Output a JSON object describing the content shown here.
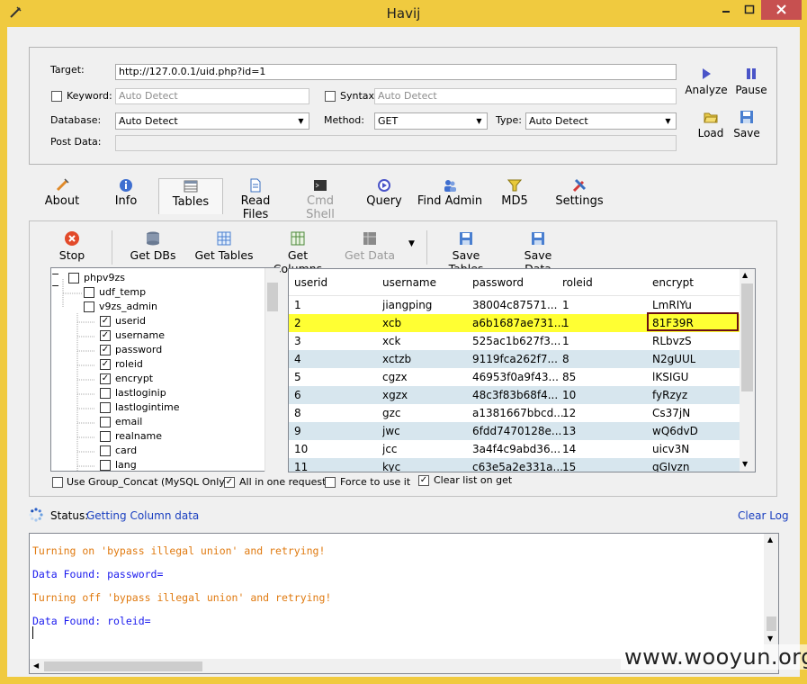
{
  "window": {
    "title": "Havij"
  },
  "target": {
    "target_label": "Target:",
    "target_value": "http://127.0.0.1/uid.php?id=1",
    "keyword_label": "Keyword:",
    "keyword_placeholder": "Auto Detect",
    "syntax_label": "Syntax:",
    "syntax_placeholder": "Auto Detect",
    "database_label": "Database:",
    "database_value": "Auto Detect",
    "method_label": "Method:",
    "method_value": "GET",
    "type_label": "Type:",
    "type_value": "Auto Detect",
    "postdata_label": "Post Data:"
  },
  "side_buttons": {
    "analyze": "Analyze",
    "pause": "Pause",
    "load": "Load",
    "save": "Save"
  },
  "tabs": [
    {
      "label": "About"
    },
    {
      "label": "Info"
    },
    {
      "label": "Tables"
    },
    {
      "label": "Read Files"
    },
    {
      "label": "Cmd Shell"
    },
    {
      "label": "Query"
    },
    {
      "label": "Find Admin"
    },
    {
      "label": "MD5"
    },
    {
      "label": "Settings"
    }
  ],
  "toolbar": {
    "stop": "Stop",
    "get_dbs": "Get DBs",
    "get_tables": "Get Tables",
    "get_columns": "Get Columns",
    "get_data": "Get Data",
    "save_tables": "Save Tables",
    "save_data": "Save Data"
  },
  "tree": {
    "db": "phpv9zs",
    "tables": [
      "udf_temp",
      "v9zs_admin"
    ],
    "columns": [
      {
        "name": "userid",
        "checked": true
      },
      {
        "name": "username",
        "checked": true
      },
      {
        "name": "password",
        "checked": true
      },
      {
        "name": "roleid",
        "checked": true
      },
      {
        "name": "encrypt",
        "checked": true
      },
      {
        "name": "lastloginip",
        "checked": false
      },
      {
        "name": "lastlogintime",
        "checked": false
      },
      {
        "name": "email",
        "checked": false
      },
      {
        "name": "realname",
        "checked": false
      },
      {
        "name": "card",
        "checked": false
      },
      {
        "name": "lang",
        "checked": false
      }
    ]
  },
  "grid": {
    "headers": [
      "userid",
      "username",
      "password",
      "roleid",
      "encrypt"
    ],
    "rows": [
      [
        "1",
        "jiangping",
        "38004c87571...",
        "1",
        "LmRIYu"
      ],
      [
        "2",
        "xcb",
        "a6b1687ae731...",
        "1",
        "81F39R"
      ],
      [
        "3",
        "xck",
        "525ac1b627f3...",
        "1",
        "RLbvzS"
      ],
      [
        "4",
        "xctzb",
        "9119fca262f7...",
        "8",
        "N2gUUL"
      ],
      [
        "5",
        "cgzx",
        "46953f0a9f43...",
        "85",
        "lKSIGU"
      ],
      [
        "6",
        "xgzx",
        "48c3f83b68f4...",
        "10",
        "fyRzyz"
      ],
      [
        "8",
        "gzc",
        "a1381667bbcd...",
        "12",
        "Cs37jN"
      ],
      [
        "9",
        "jwc",
        "6fdd7470128e...",
        "13",
        "wQ6dvD"
      ],
      [
        "10",
        "jcc",
        "3a4f4c9abd36...",
        "14",
        "uicv3N"
      ],
      [
        "11",
        "kyc",
        "c63e5a2e331a...",
        "15",
        "qGIvzn"
      ]
    ]
  },
  "options": {
    "group_concat": "Use Group_Concat (MySQL Only)",
    "all_in_one": "All in one request.",
    "force": "Force to use it",
    "clear_list": "Clear list on get"
  },
  "status": {
    "label": "Status:",
    "value": "Getting Column data",
    "clear_log": "Clear Log"
  },
  "log": [
    {
      "text": "Turning on 'bypass illegal union' and retrying!",
      "color": "orange"
    },
    {
      "text": "Data Found: password=",
      "color": "blue"
    },
    {
      "text": "Turning off 'bypass illegal union' and retrying!",
      "color": "orange"
    },
    {
      "text": "Data Found: roleid=",
      "color": "blue"
    }
  ],
  "watermark": "www.wooyun.org",
  "colors": {
    "title_bar": "#f0ca3f",
    "selected_row": "#ffff33",
    "alt_row": "#d7e6ee",
    "log_orange": "#e07a10",
    "log_blue": "#1a1aee",
    "close_button": "#c75050"
  }
}
